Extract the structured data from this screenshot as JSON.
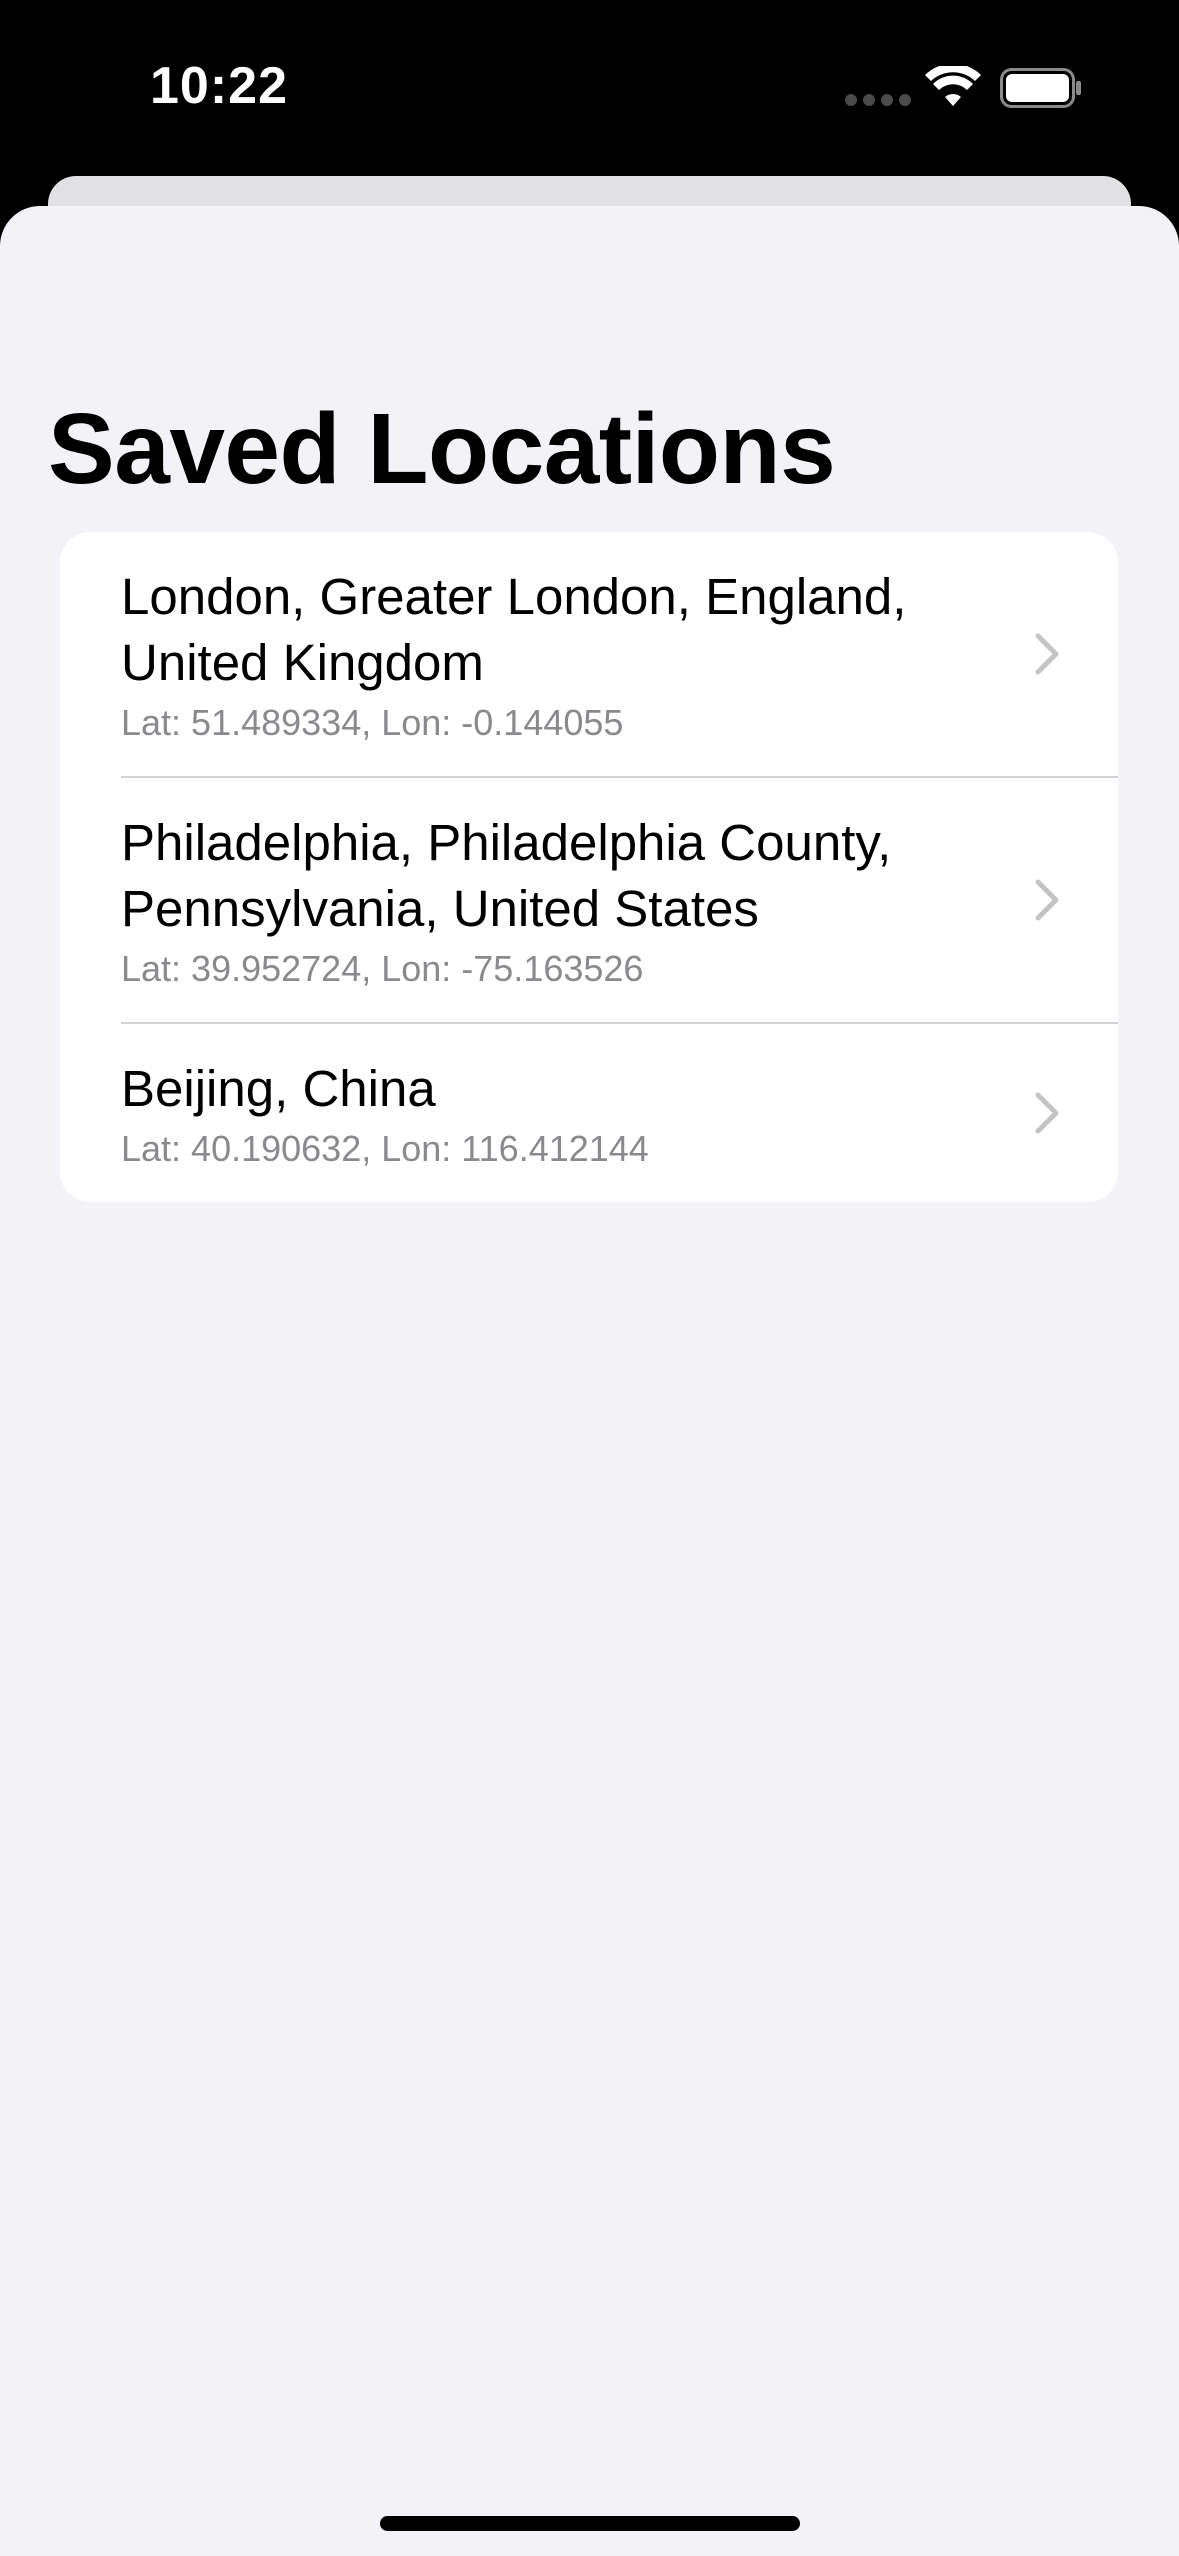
{
  "status_bar": {
    "time": "10:22"
  },
  "header": {
    "title": "Saved Locations"
  },
  "locations": [
    {
      "name": "London, Greater London, England, United Kingdom",
      "coords": "Lat: 51.489334, Lon: -0.144055"
    },
    {
      "name": "Philadelphia, Philadelphia County, Pennsylvania, United States",
      "coords": "Lat: 39.952724, Lon: -75.163526"
    },
    {
      "name": "Beijing, China",
      "coords": "Lat: 40.190632, Lon: 116.412144"
    }
  ],
  "icons": {
    "wifi": "wifi-icon",
    "battery": "battery-icon",
    "chevron": "chevron-right-icon"
  },
  "colors": {
    "background": "#f2f2f7",
    "card": "#ffffff",
    "subtitle": "#8a8a8e",
    "chevron": "#c4c4c7",
    "divider": "#d1d1d6"
  }
}
